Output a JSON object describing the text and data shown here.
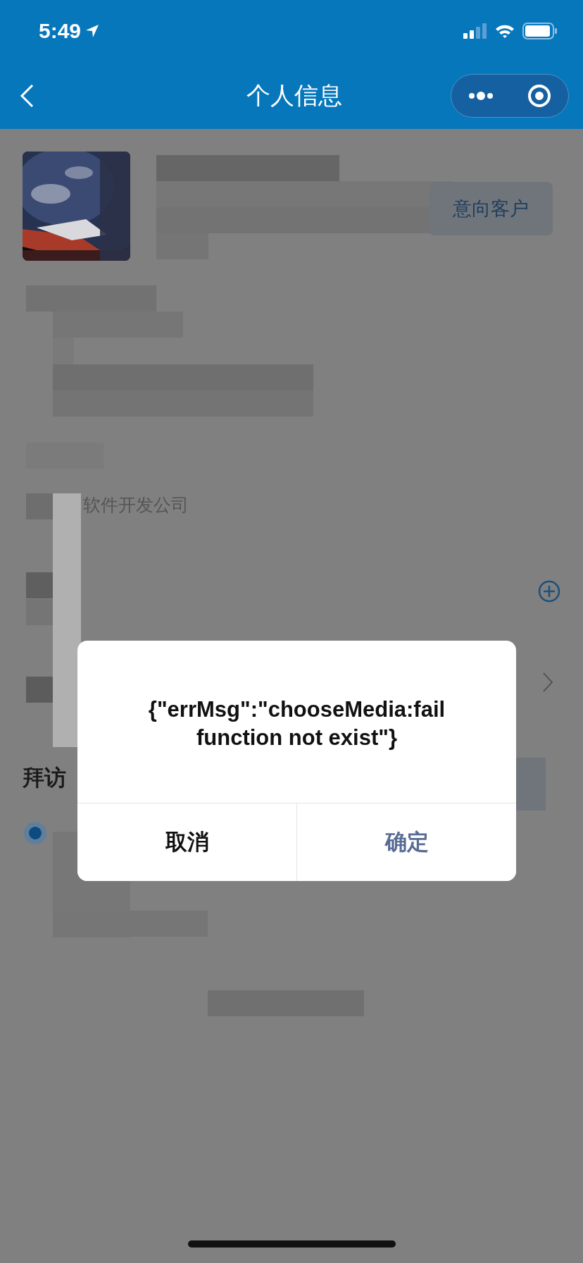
{
  "status_bar": {
    "time": "5:49"
  },
  "nav_bar": {
    "title": "个人信息"
  },
  "profile": {
    "tag": "意向客户"
  },
  "company": "软件开发公司",
  "section_title": "拜访",
  "dialog": {
    "message": "{\"errMsg\":\"chooseMedia:fail function not exist\"}",
    "buttons": [
      {
        "label": "取消",
        "kind": "cancel"
      },
      {
        "label": "确定",
        "kind": "confirm"
      }
    ]
  }
}
